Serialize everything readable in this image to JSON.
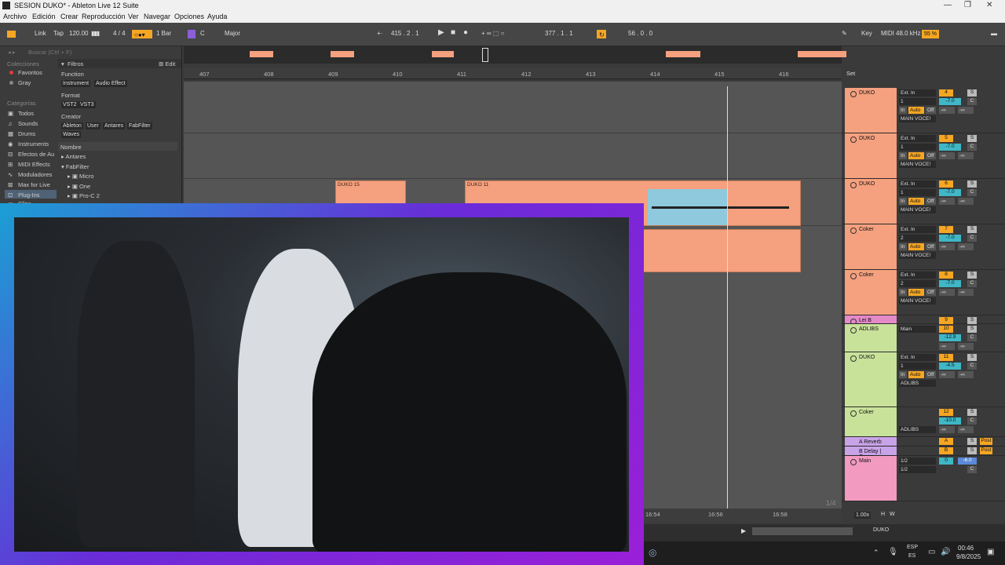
{
  "window": {
    "title": "SESION DUKO* - Ableton Live 12 Suite"
  },
  "menu": [
    "Archivo",
    "Edición",
    "Crear",
    "Reproducción",
    "Ver",
    "Navegar",
    "Opciones",
    "Ayuda"
  ],
  "transport": {
    "link": "Link",
    "tap": "Tap",
    "tempo": "120.00",
    "signature": "4 / 4",
    "quantize": "1 Bar",
    "key": "C",
    "scale": "Major",
    "position": "415 .  2 .  1",
    "loop_start": "377 .  1 .  1",
    "loop_length": "56 .  0 .  0",
    "key_label": "Key",
    "midi_label": "MIDI",
    "sample_rate": "48.0 kHz",
    "cpu": "55 %"
  },
  "browser": {
    "search_placeholder": "Buscar (Ctrl + F)",
    "collections_header": "Colecciones",
    "collections": [
      "Favoritos",
      "Gray"
    ],
    "categories_header": "Categorías",
    "categories": [
      "Todos",
      "Sounds",
      "Drums",
      "Instruments",
      "Efectos de Au",
      "MIDI Effects",
      "Moduladores",
      "Max for Live",
      "Plug-Ins",
      "Clips"
    ],
    "filters_label": "Filtros",
    "edit_label": "Edit",
    "function_label": "Function",
    "function_chips": [
      "Instrument",
      "Audio Effect"
    ],
    "format_label": "Format",
    "format_chips": [
      "VST2",
      "VST3"
    ],
    "creator_label": "Creator",
    "creator_chips": [
      "Ableton",
      "User",
      "Antares",
      "FabFilter",
      "Waves"
    ],
    "name_header": "Nombre",
    "tree": [
      "Antares",
      "FabFilter",
      "Micro",
      "One",
      "Pro-C 2"
    ]
  },
  "ruler": [
    "407",
    "408",
    "409",
    "410",
    "411",
    "412",
    "413",
    "414",
    "415",
    "416"
  ],
  "set_label": "Set",
  "clips": [
    {
      "name": "DUKO 15"
    },
    {
      "name": "DUKO 11"
    }
  ],
  "tracks": [
    {
      "name": "DUKO",
      "input": "Ext. In",
      "ch": "1",
      "num": "4",
      "vol": "-7.0",
      "out": "MAIN VOCE!",
      "color": "#f5a07e"
    },
    {
      "name": "DUKO",
      "input": "Ext. In",
      "ch": "1",
      "num": "5",
      "vol": "-7.0",
      "out": "MAIN VOCE!",
      "color": "#f5a07e"
    },
    {
      "name": "DUKO",
      "input": "Ext. In",
      "ch": "1",
      "num": "6",
      "vol": "-7.0",
      "out": "MAIN VOCE!",
      "color": "#f5a07e"
    },
    {
      "name": "Coker",
      "input": "Ext. In",
      "ch": "2",
      "num": "7",
      "vol": "-7.0",
      "out": "MAIN VOCE!",
      "color": "#f5a07e"
    },
    {
      "name": "Coker",
      "input": "Ext. In",
      "ch": "2",
      "num": "8",
      "vol": "-7.0",
      "out": "MAIN VOCE!",
      "color": "#f5a07e"
    },
    {
      "name": "Lei B",
      "input": "",
      "ch": "",
      "num": "9",
      "vol": "",
      "out": "",
      "color": "#e58ac9"
    },
    {
      "name": "ADLIBS",
      "input": "Main",
      "ch": "",
      "num": "10",
      "vol": "-12.9",
      "out": "",
      "color": "#c8e29a"
    },
    {
      "name": "DUKO",
      "input": "Ext. In",
      "ch": "1",
      "num": "11",
      "vol": "-4.5",
      "out": "ADLIBS",
      "color": "#c8e29a"
    },
    {
      "name": "Coker",
      "input": "",
      "ch": "",
      "num": "12",
      "vol": "-10.0",
      "out": "ADLIBS",
      "color": "#c8e29a"
    }
  ],
  "returns": [
    {
      "name": "A Reverb",
      "num": "A",
      "post": "Post"
    },
    {
      "name": "B Delay | Comp",
      "num": "B",
      "post": "Post"
    }
  ],
  "main_track": {
    "name": "Main",
    "io1": "1/2",
    "io2": "1/2",
    "num": "0",
    "vol": "-6.0"
  },
  "io_labels": {
    "in": "In",
    "auto": "Auto",
    "off": "Off",
    "inf": "-∞",
    "s": "S",
    "c": "C"
  },
  "timeline_bottom": {
    "t1": "16:54",
    "t2": "16:56",
    "t3": "16:58",
    "page": "1/4",
    "zoom": "1.00x",
    "h": "H",
    "w": "W",
    "clip_label": "DUKO"
  },
  "taskbar": {
    "lang1": "ESP",
    "lang2": "ES",
    "time": "00:46",
    "date": "9/8/2025"
  }
}
